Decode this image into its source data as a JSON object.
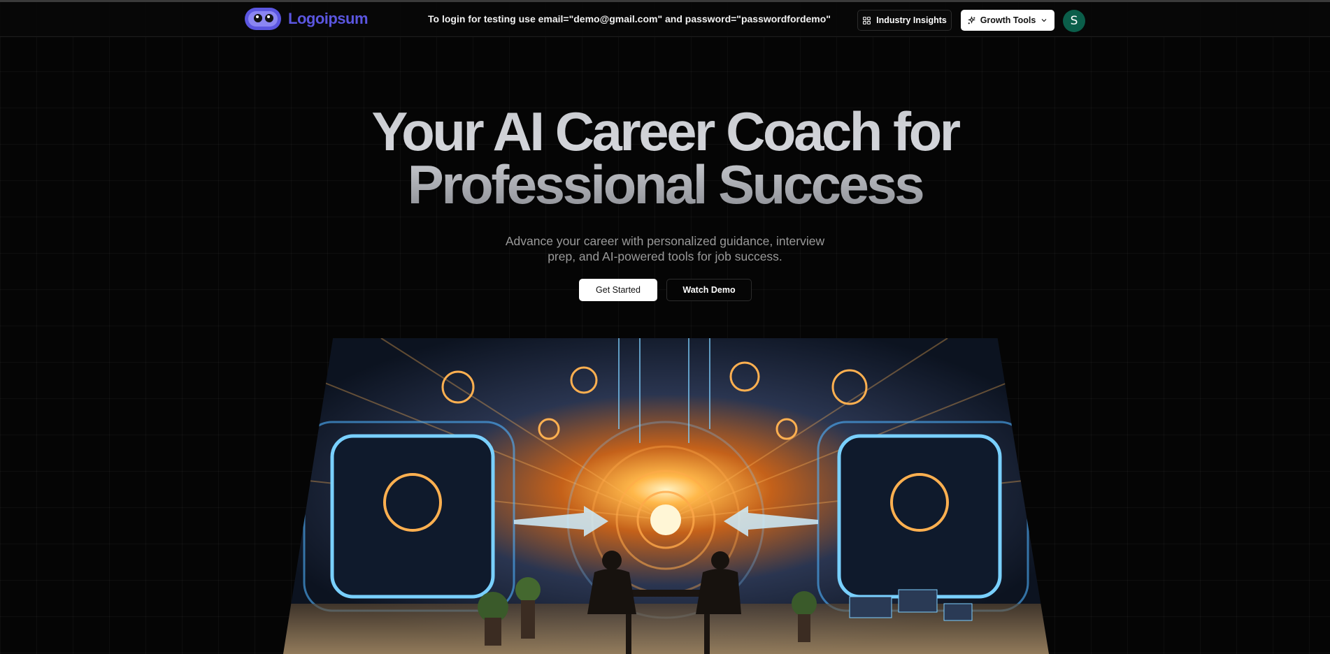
{
  "header": {
    "logo_text": "Logoipsum",
    "login_note": "To login for testing use email=\"demo@gmail.com\" and password=\"passwordfordemo\"",
    "industry_insights_label": "Industry Insights",
    "growth_tools_label": "Growth Tools",
    "avatar_initial": "S"
  },
  "hero": {
    "title_line1": "Your AI Career Coach for",
    "title_line2": "Professional Success",
    "subtitle": "Advance your career with personalized guidance, interview prep, and AI-powered tools for job success.",
    "get_started_label": "Get Started",
    "watch_demo_label": "Watch Demo"
  },
  "colors": {
    "background": "#050505",
    "brand": "#5b56e0",
    "avatar_bg": "#0b5e4a"
  },
  "icons": {
    "industry_insights": "layout-grid-icon",
    "growth_tools": "sparkles-icon",
    "dropdown": "chevron-down-icon"
  }
}
